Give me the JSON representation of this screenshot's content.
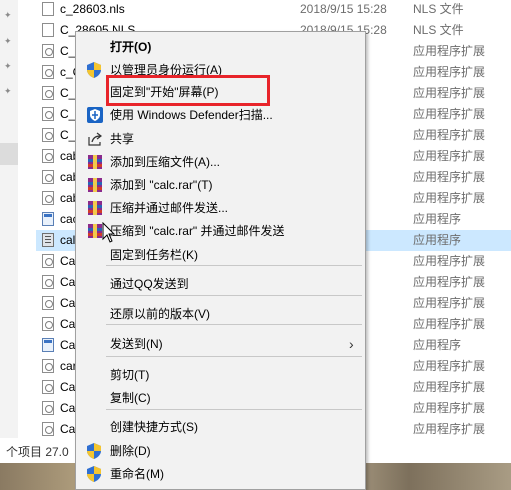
{
  "files": [
    {
      "name": "c_28603.nls",
      "date": "2018/9/15 15:28",
      "type": "NLS 文件",
      "icon": "file-icon"
    },
    {
      "name": "C_28605.NLS",
      "date": "2018/9/15 15:28",
      "type": "NLS 文件",
      "icon": "file-icon"
    },
    {
      "name": "C_0",
      "date": "15:28",
      "type": "应用程序扩展",
      "icon": "dll-icon"
    },
    {
      "name": "c_C",
      "date": "15:28",
      "type": "应用程序扩展",
      "icon": "dll-icon"
    },
    {
      "name": "C_0",
      "date": "15:28",
      "type": "应用程序扩展",
      "icon": "dll-icon"
    },
    {
      "name": "C_I",
      "date": "15:28",
      "type": "应用程序扩展",
      "icon": "dll-icon"
    },
    {
      "name": "C_I",
      "date": "15:28",
      "type": "应用程序扩展",
      "icon": "dll-icon"
    },
    {
      "name": "cab",
      "date": "15:28",
      "type": "应用程序扩展",
      "icon": "dll-icon"
    },
    {
      "name": "cab",
      "date": "15:28",
      "type": "应用程序扩展",
      "icon": "dll-icon"
    },
    {
      "name": "cab",
      "date": "15:28",
      "type": "应用程序扩展",
      "icon": "dll-icon"
    },
    {
      "name": "cac",
      "date": "15:29",
      "type": "应用程序",
      "icon": "app-icon"
    },
    {
      "name": "calc",
      "date": "15:29",
      "type": "应用程序",
      "icon": "calc-icon",
      "selected": true
    },
    {
      "name": "Ca",
      "date": "15:28",
      "type": "应用程序扩展",
      "icon": "dll-icon"
    },
    {
      "name": "Ca",
      "date": "15:28",
      "type": "应用程序扩展",
      "icon": "dll-icon"
    },
    {
      "name": "Ca",
      "date": "15:28",
      "type": "应用程序扩展",
      "icon": "dll-icon"
    },
    {
      "name": "Ca",
      "date": ":44",
      "type": "应用程序扩展",
      "icon": "dll-icon"
    },
    {
      "name": "Ca",
      "date": ":06",
      "type": "应用程序",
      "icon": "app-icon"
    },
    {
      "name": "car",
      "date": "15:28",
      "type": "应用程序扩展",
      "icon": "dll-icon"
    },
    {
      "name": "Ca",
      "date": "15:28",
      "type": "应用程序扩展",
      "icon": "dll-icon"
    },
    {
      "name": "Ca",
      "date": ":44",
      "type": "应用程序扩展",
      "icon": "dll-icon"
    },
    {
      "name": "Ca",
      "date": "15:28",
      "type": "应用程序扩展",
      "icon": "dll-icon"
    },
    {
      "name": "cap",
      "date": "15:28",
      "type": "应用程序扩展",
      "icon": "dll-icon"
    }
  ],
  "status": {
    "text": "个项目  27.0"
  },
  "menu": {
    "items": [
      {
        "label": "打开(O)",
        "bold": true,
        "icon": ""
      },
      {
        "label": "以管理员身份运行(A)",
        "icon": "uac-shield-icon"
      },
      {
        "label": "固定到\"开始\"屏幕(P)",
        "icon": ""
      },
      {
        "label": "使用 Windows Defender扫描...",
        "icon": "defender-icon"
      },
      {
        "label": "共享",
        "icon": "share-icon"
      },
      {
        "label": "添加到压缩文件(A)...",
        "icon": "winrar-icon"
      },
      {
        "label": "添加到 \"calc.rar\"(T)",
        "icon": "winrar-icon"
      },
      {
        "label": "压缩并通过邮件发送...",
        "icon": "winrar-icon"
      },
      {
        "label": "压缩到 \"calc.rar\" 并通过邮件发送",
        "icon": "winrar-icon"
      },
      {
        "label": "固定到任务栏(K)",
        "icon": ""
      },
      {
        "label": "通过QQ发送到",
        "icon": ""
      },
      {
        "label": "还原以前的版本(V)",
        "icon": ""
      },
      {
        "label": "发送到(N)",
        "icon": "",
        "submenu": true
      },
      {
        "label": "剪切(T)",
        "icon": ""
      },
      {
        "label": "复制(C)",
        "icon": ""
      },
      {
        "label": "创建快捷方式(S)",
        "icon": ""
      },
      {
        "label": "删除(D)",
        "icon": "uac-shield-icon"
      },
      {
        "label": "重命名(M)",
        "icon": "uac-shield-icon"
      }
    ]
  },
  "colors": {
    "highlight_box": "#e8242a",
    "selection": "#cce8ff",
    "menu_bg": "#f2f2f2"
  }
}
